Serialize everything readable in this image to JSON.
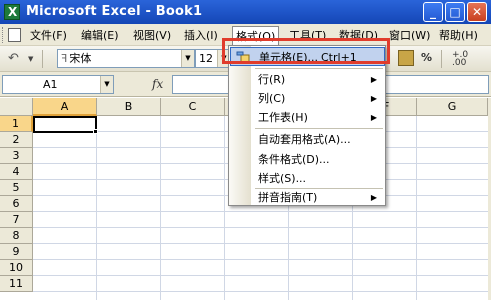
{
  "window": {
    "title": "Microsoft Excel - Book1",
    "app_icon_letter": "X",
    "buttons": [
      "minimize",
      "maximize",
      "close"
    ]
  },
  "menubar": {
    "items": [
      "文件(F)",
      "编辑(E)",
      "视图(V)",
      "插入(I)",
      "格式(O)",
      "工具(T)",
      "数据(D)",
      "窗口(W)",
      "帮助(H)"
    ],
    "active_index": 4,
    "right_controls": [
      "_",
      "♯",
      "×"
    ]
  },
  "toolbar": {
    "font_name": "宋体",
    "font_size": "12",
    "percent_label": "%",
    "decimal_label": "+.0\n.00"
  },
  "formula_bar": {
    "name_box": "A1",
    "fx_label": "fx",
    "formula": ""
  },
  "grid": {
    "columns": [
      "A",
      "B",
      "C",
      "D",
      "E",
      "F",
      "G"
    ],
    "rows": [
      "1",
      "2",
      "3",
      "4",
      "5",
      "6",
      "7",
      "8",
      "9",
      "10",
      "11"
    ],
    "selected_cell": "A1"
  },
  "format_menu": {
    "items": [
      {
        "label": "单元格(E)...",
        "shortcut": "Ctrl+1",
        "submenu": false,
        "highlighted": true,
        "icon": "cell-format-icon"
      },
      {
        "label": "行(R)",
        "shortcut": "",
        "submenu": true
      },
      {
        "label": "列(C)",
        "shortcut": "",
        "submenu": true
      },
      {
        "label": "工作表(H)",
        "shortcut": "",
        "submenu": true
      },
      {
        "label": "自动套用格式(A)...",
        "shortcut": "",
        "submenu": false
      },
      {
        "label": "条件格式(D)...",
        "shortcut": "",
        "submenu": false
      },
      {
        "label": "样式(S)...",
        "shortcut": "",
        "submenu": false
      },
      {
        "label": "拼音指南(T)",
        "shortcut": "",
        "submenu": true
      }
    ]
  },
  "colors": {
    "titlebar": "#1f55c8",
    "menu_highlight": "#c1d2ee",
    "annotation_outline": "#e03c2c",
    "selected_header": "#f9d68a"
  }
}
